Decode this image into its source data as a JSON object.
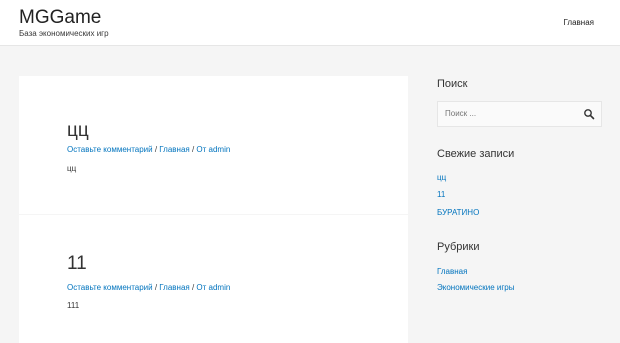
{
  "header": {
    "site_title": "MGGame",
    "site_description": "База экономических игр",
    "nav": {
      "home": "Главная"
    }
  },
  "posts": [
    {
      "title": "цц",
      "meta": {
        "comments": "Оставьте комментарий",
        "category": "Главная",
        "author_prefix": "От",
        "author": "admin"
      },
      "excerpt": "цц"
    },
    {
      "title": "11",
      "meta": {
        "comments": "Оставьте комментарий",
        "category": "Главная",
        "author_prefix": "От",
        "author": "admin"
      },
      "excerpt": "111"
    }
  ],
  "sidebar": {
    "search": {
      "title": "Поиск",
      "placeholder": "Поиск ..."
    },
    "recent": {
      "title": "Свежие записи",
      "items": [
        "цц",
        "11",
        "БУРАТИНО"
      ]
    },
    "categories": {
      "title": "Рубрики",
      "items": [
        "Главная",
        "Экономические игры"
      ]
    }
  },
  "colors": {
    "link": "#0274be",
    "background": "#f5f5f5",
    "card": "#ffffff",
    "text": "#3a3a3a"
  },
  "icons": {
    "search": "search-icon"
  }
}
